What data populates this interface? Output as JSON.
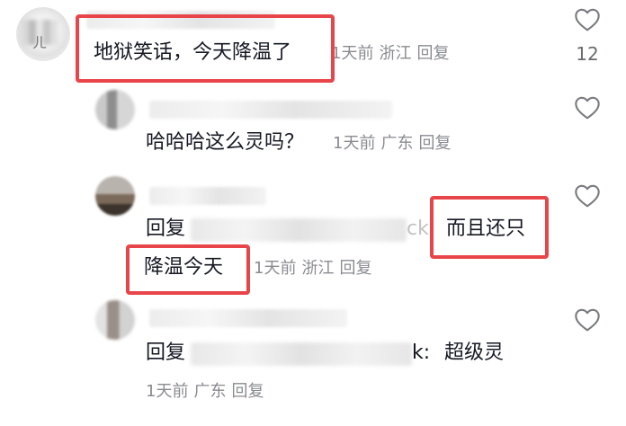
{
  "comments": [
    {
      "text": "地狱笑话，今天降温了",
      "meta": {
        "time": "1天前",
        "location": "浙江",
        "reply": "回复"
      },
      "likes": "12",
      "highlighted": true
    }
  ],
  "replies": [
    {
      "text": "哈哈哈这么灵吗？",
      "meta": {
        "time": "1天前",
        "location": "广东",
        "reply": "回复"
      }
    },
    {
      "reply_prefix": "回复",
      "mention_tail": "ck",
      "text_line1": "而且还只",
      "text_line2": "降温今天",
      "meta": {
        "time": "1天前",
        "location": "浙江",
        "reply": "回复"
      },
      "highlighted": true
    },
    {
      "reply_prefix": "回复",
      "mention_tail": "k:",
      "text": "超级灵",
      "meta": {
        "time": "1天前",
        "location": "广东",
        "reply": "回复"
      }
    }
  ],
  "icons": {
    "like": "heart-outline-icon"
  },
  "colors": {
    "highlight": "#e8454a",
    "meta": "#8a8b91",
    "text": "#161823"
  }
}
